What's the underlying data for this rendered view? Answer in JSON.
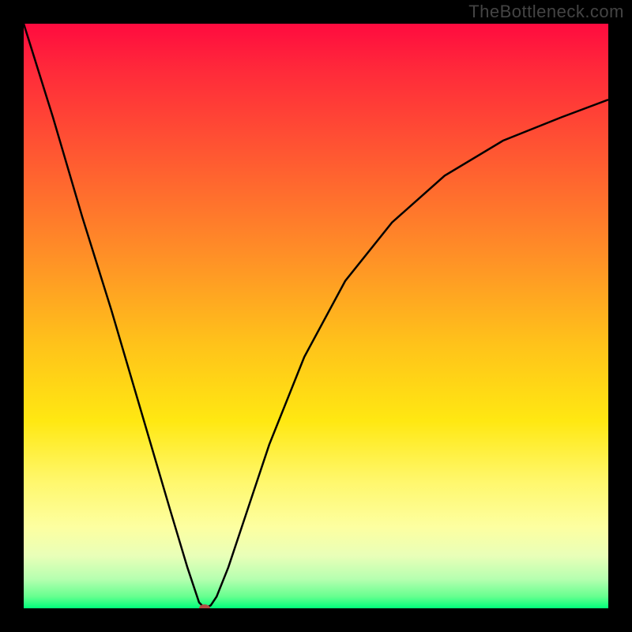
{
  "watermark": "TheBottleneck.com",
  "chart_data": {
    "type": "line",
    "title": "",
    "xlabel": "",
    "ylabel": "",
    "xlim": [
      0,
      100
    ],
    "ylim": [
      0,
      100
    ],
    "grid": false,
    "legend": false,
    "gradient_stops": [
      {
        "pos": 0,
        "color": "#ff0b3f"
      },
      {
        "pos": 8,
        "color": "#ff2a3a"
      },
      {
        "pos": 20,
        "color": "#ff5033"
      },
      {
        "pos": 38,
        "color": "#ff8a28"
      },
      {
        "pos": 55,
        "color": "#ffc31a"
      },
      {
        "pos": 68,
        "color": "#ffe812"
      },
      {
        "pos": 78,
        "color": "#fff76a"
      },
      {
        "pos": 86,
        "color": "#fdffa0"
      },
      {
        "pos": 91,
        "color": "#e9ffb8"
      },
      {
        "pos": 95,
        "color": "#b6ffb0"
      },
      {
        "pos": 98,
        "color": "#66ff8f"
      },
      {
        "pos": 100,
        "color": "#00ff7a"
      }
    ],
    "series": [
      {
        "name": "bottleneck-curve",
        "x": [
          0,
          5,
          10,
          15,
          20,
          25,
          28,
          30,
          31,
          32,
          33,
          35,
          38,
          42,
          48,
          55,
          63,
          72,
          82,
          92,
          100
        ],
        "y": [
          100,
          84,
          67,
          51,
          34,
          17,
          7,
          1,
          0,
          0.5,
          2,
          7,
          16,
          28,
          43,
          56,
          66,
          74,
          80,
          84,
          87
        ]
      }
    ],
    "marker": {
      "x": 31,
      "y": 0,
      "color": "#b24c45"
    }
  }
}
